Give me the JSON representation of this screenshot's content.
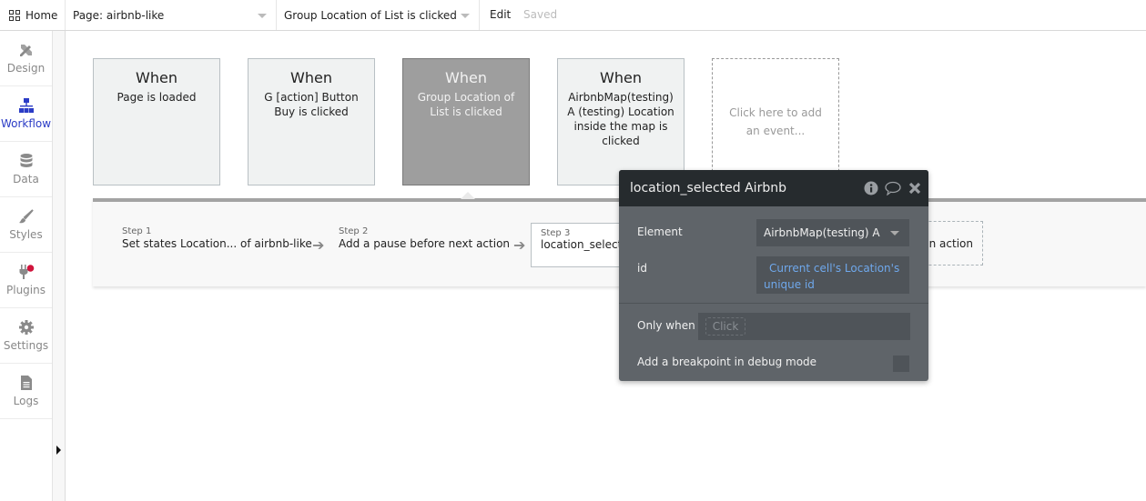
{
  "topbar": {
    "home_label": "Home",
    "page_dropdown": "Page: airbnb-like",
    "event_dropdown": "Group Location of List is clicked",
    "edit_label": "Edit",
    "saved_label": "Saved"
  },
  "sidebar": {
    "items": [
      {
        "label": "Design",
        "icon": "design-icon"
      },
      {
        "label": "Workflow",
        "icon": "workflow-icon",
        "active": true
      },
      {
        "label": "Data",
        "icon": "database-icon"
      },
      {
        "label": "Styles",
        "icon": "brush-icon"
      },
      {
        "label": "Plugins",
        "icon": "plug-icon"
      },
      {
        "label": "Settings",
        "icon": "gear-icon"
      },
      {
        "label": "Logs",
        "icon": "document-icon"
      }
    ]
  },
  "events": [
    {
      "when": "When",
      "desc": "Page is loaded"
    },
    {
      "when": "When",
      "desc": "G [action] Button Buy is clicked"
    },
    {
      "when": "When",
      "desc": "Group Location of List is clicked",
      "selected": true
    },
    {
      "when": "When",
      "desc": "AirbnbMap(testing) A (testing) Location inside the map is clicked"
    }
  ],
  "add_event_label": "Click here to add an event...",
  "steps": [
    {
      "num": "Step 1",
      "text": "Set states Location... of airbnb-like"
    },
    {
      "num": "Step 2",
      "text": "Add a pause before next action"
    },
    {
      "num": "Step 3",
      "text": "location_selected Airbnb"
    }
  ],
  "add_action_label": "Click here to add an action...",
  "popup": {
    "title": "location_selected Airbnb",
    "element_label": "Element",
    "element_value": "AirbnbMap(testing) A",
    "id_label": "id",
    "id_value": "Current cell's Location's unique id",
    "only_when_label": "Only when",
    "only_when_placeholder": "Click",
    "breakpoint_label": "Add a breakpoint in debug mode",
    "breakpoint_checked": false
  },
  "colors": {
    "accent": "#2b3cc6",
    "plugin_badge": "#d0143c",
    "popup_bg": "#5f6469",
    "popup_header": "#262b2e",
    "expression_text": "#6fa8ec",
    "selected_event": "#9e9e9e"
  }
}
